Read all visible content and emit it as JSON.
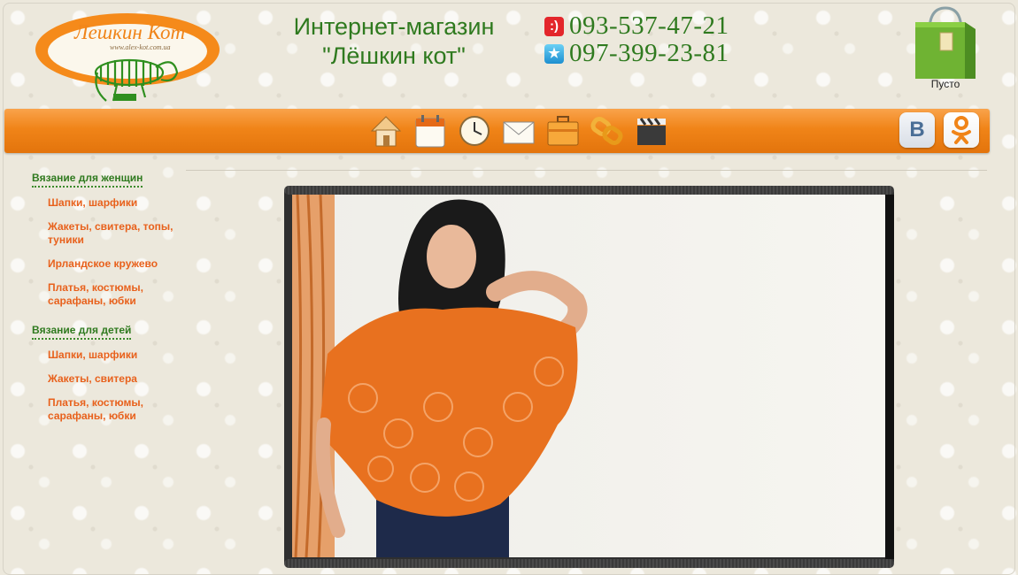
{
  "header": {
    "logo_text": "Лешкин Кот",
    "logo_url_text": "www.alex-kot.com.ua",
    "shop_title_line1": "Интернет-магазин",
    "shop_title_line2": "\"Лёшкин кот\"",
    "phones": [
      {
        "operator_icon": "mts-icon",
        "number": "093-537-47-21"
      },
      {
        "operator_icon": "kyivstar-icon",
        "number": "097-399-23-81"
      }
    ],
    "cart": {
      "icon": "shopping-bag-icon",
      "status": "Пусто"
    }
  },
  "nav": {
    "icons": [
      "home-icon",
      "calendar-icon",
      "clock-icon",
      "mail-icon",
      "briefcase-icon",
      "chain-link-icon",
      "clapperboard-icon"
    ],
    "social": [
      "vk-icon",
      "odnoklassniki-icon"
    ],
    "vk_letter": "B"
  },
  "sidebar": {
    "categories": [
      {
        "title": "Вязание для женщин",
        "items": [
          "Шапки, шарфики",
          "Жакеты, свитера, топы, туники",
          "Ирландское кружево",
          "Платья, костюмы, сарафаны, юбки"
        ]
      },
      {
        "title": "Вязание для детей",
        "items": [
          "Шапки, шарфики",
          "Жакеты, свитера",
          "Платья, костюмы, сарафаны, юбки"
        ]
      }
    ]
  },
  "colors": {
    "accent_orange": "#f08418",
    "title_green": "#2f7a1f",
    "link_orange": "#e8611c"
  }
}
